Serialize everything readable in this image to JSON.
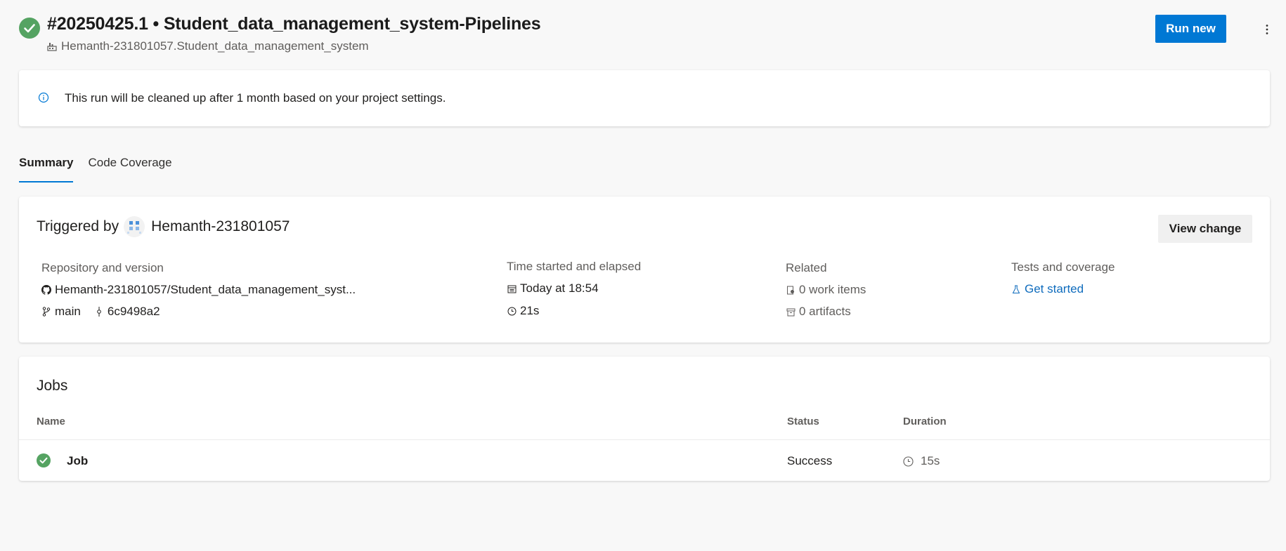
{
  "header": {
    "run_title": "#20250425.1 • Student_data_management_system-Pipelines",
    "repo_path": "Hemanth-231801057.Student_data_management_system",
    "run_new_label": "Run new",
    "status_color": "#55a362",
    "accent_color": "#0078d4"
  },
  "banner": {
    "text": "This run will be cleaned up after 1 month based on your project settings."
  },
  "tabs": [
    {
      "label": "Summary",
      "active": true
    },
    {
      "label": "Code Coverage",
      "active": false
    }
  ],
  "summary": {
    "triggered_prefix": "Triggered by",
    "triggered_user": "Hemanth-231801057",
    "view_change_label": "View change",
    "repository": {
      "heading": "Repository and version",
      "repo": "Hemanth-231801057/Student_data_management_syst...",
      "branch": "main",
      "commit": "6c9498a2"
    },
    "time": {
      "heading": "Time started and elapsed",
      "started": "Today at 18:54",
      "elapsed": "21s"
    },
    "related": {
      "heading": "Related",
      "work_items": "0 work items",
      "artifacts": "0 artifacts"
    },
    "tests": {
      "heading": "Tests and coverage",
      "link": "Get started"
    }
  },
  "jobs": {
    "title": "Jobs",
    "columns": [
      "Name",
      "Status",
      "Duration"
    ],
    "rows": [
      {
        "name": "Job",
        "status": "Success",
        "duration": "15s"
      }
    ]
  },
  "icons": {
    "run_status": "check-circle-icon",
    "repo": "pipeline-icon",
    "more": "more-vertical-icon",
    "info": "info-icon",
    "avatar": "user-avatar-icon",
    "github": "github-icon",
    "branch": "branch-icon",
    "commit": "commit-icon",
    "calendar": "calendar-icon",
    "clock": "clock-icon",
    "work_items": "work-item-icon",
    "artifacts": "artifact-icon",
    "tests": "flask-icon"
  }
}
